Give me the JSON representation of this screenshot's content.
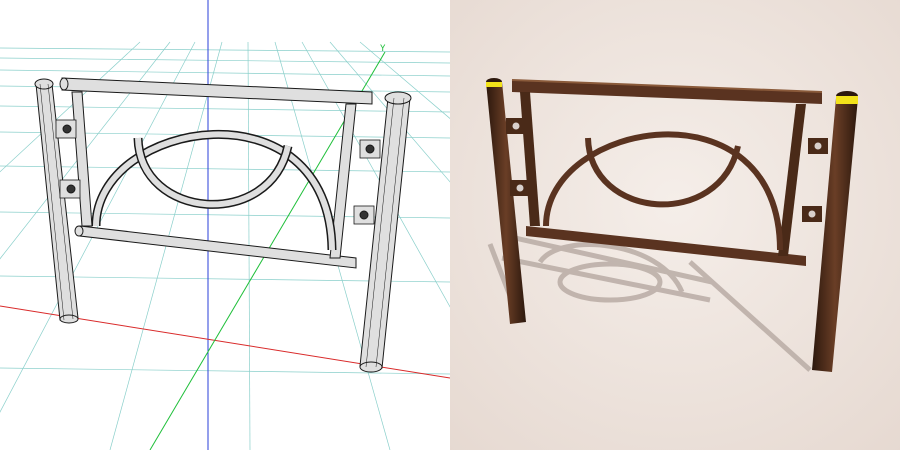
{
  "viewport": {
    "axis_y_label": "Y"
  },
  "colors": {
    "left_background": "#ffffff",
    "grid_line": "#2aa8a0",
    "axis_x": "#d92a2a",
    "axis_y": "#2a3fd9",
    "axis_z": "#1fbf3a",
    "wire_fill": "#dfdfdf",
    "wire_stroke": "#1a1a1a",
    "render_background": "#efe5df",
    "post_brown": "#4a2a18",
    "rail_brown": "#5a3320",
    "reflector_yellow": "#f2e21a",
    "shadow": "#b9aca5"
  },
  "objects": {
    "left_view": "wireframe-fence-model",
    "right_view": "rendered-fence-model"
  }
}
